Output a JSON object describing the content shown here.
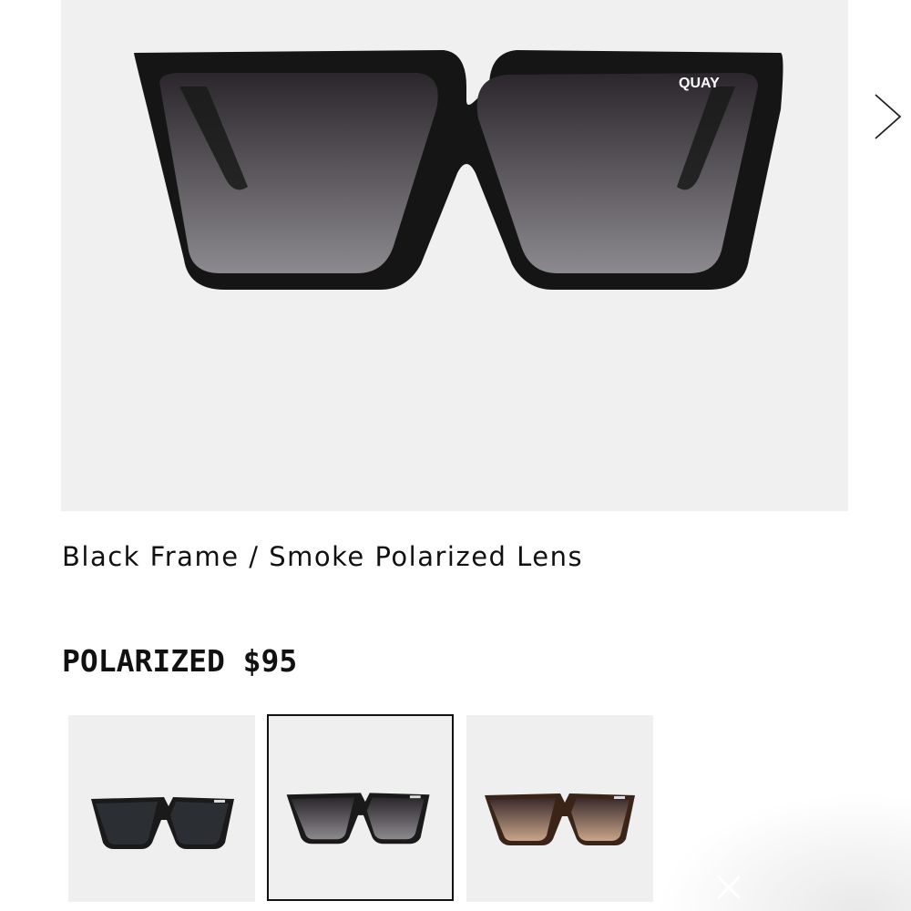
{
  "product": {
    "brand_logo": "QUAY",
    "variant_title": "Black Frame / Smoke Polarized Lens",
    "price_line": "POLARIZED $95"
  },
  "gallery": {
    "next_icon": "chevron-right-icon"
  },
  "swatches": [
    {
      "name": "black-smoke-lens",
      "selected": false,
      "frame_color": "#1a1a1a",
      "lens_color": "#2b2f33"
    },
    {
      "name": "black-smoke-polarized",
      "selected": true,
      "frame_color": "#1a1a1a",
      "lens_color": "#4a4a50"
    },
    {
      "name": "tortoise-brown-gradient",
      "selected": false,
      "frame_color": "#3a2418",
      "lens_color": "#7a5a4a"
    }
  ],
  "overlay": {
    "close_icon": "close-icon"
  }
}
